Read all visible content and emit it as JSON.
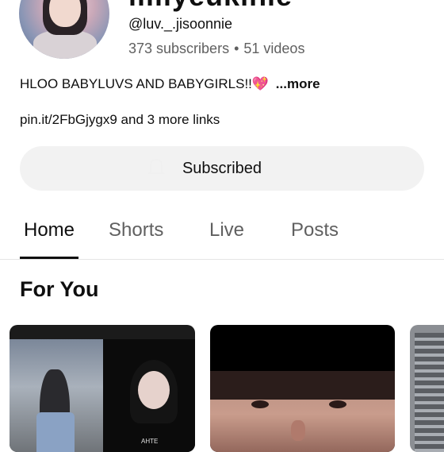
{
  "channel": {
    "name": "lililyeukinie",
    "handle": "@luv._.jisoonnie",
    "subscribers": "373 subscribers",
    "separator": "•",
    "videos": "51 videos",
    "description": "HLOO BABYLUVS AND BABYGIRLS!!",
    "description_emoji": "💖",
    "more_label": "...more",
    "links": "pin.it/2FbGjygx9 and 3 more links",
    "subscribe_label": "Subscribed"
  },
  "tabs": [
    {
      "label": "Home",
      "active": true
    },
    {
      "label": "Shorts",
      "active": false
    },
    {
      "label": "Live",
      "active": false
    },
    {
      "label": "Posts",
      "active": false
    }
  ],
  "sections": {
    "for_you_title": "For You"
  },
  "thumbnails": {
    "card1_shirt_text": "AHTE"
  },
  "colors": {
    "background": "#ffffff",
    "text_primary": "#0f0f0f",
    "text_secondary": "#606060",
    "button_bg": "#f2f2f2",
    "heart": "#e0457b"
  }
}
